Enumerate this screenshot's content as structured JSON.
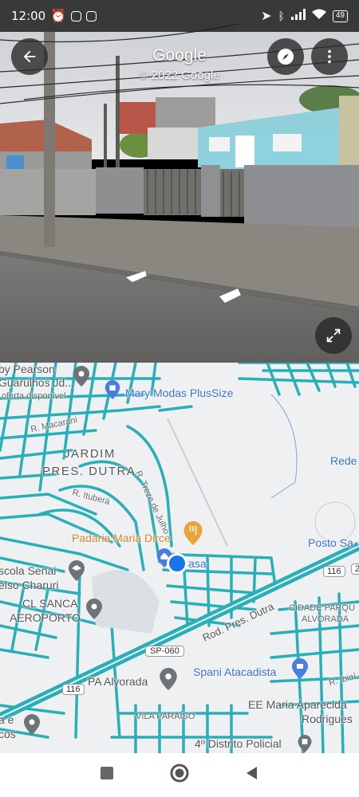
{
  "status_bar": {
    "time": "12:00",
    "battery": "49"
  },
  "street_view": {
    "title": "Google",
    "copyright": "© 2022 Google"
  },
  "map": {
    "labels": {
      "by_pearson": "by Pearson",
      "guarulhos": "Guarulhos Jd...",
      "oferta": "oferta disponível",
      "mary_modas": "Mary Modas PlusSize",
      "r_macarani": "R. Macarani",
      "jardim_1": "JARDIM",
      "jardim_2": "PRES. DUTRA",
      "r_treze": "R. Treze de Julho",
      "r_itubera": "R. Ituberá",
      "rede": "Rede",
      "padaria": "Padaria Maria Dirce",
      "posto": "Posto Sa",
      "escola_1": "scola Senai",
      "escola_2": "elso Charuri",
      "casa": "Casa",
      "cl_sanca_1": "CL SANCA",
      "cl_sanca_2": "AEROPORTO",
      "rod_dutra": "Rod. Pres. Dutra",
      "shield_116a": "116",
      "shield_2": "2",
      "cidade_1": "CIDADE PARQU",
      "cidade_2": "ALVORADA",
      "sp060": "SP-060",
      "spani": "Spani Atacadista",
      "r_ibiai": "R. Ibiaí",
      "shield_116b": "116",
      "pa_alvorada": "PA Alvorada",
      "ee_1": "EE Maria Aparecida",
      "ee_2": "Rodrigues",
      "vila_paraiso": "VILA PARAÍSO",
      "e_left_1": "a e",
      "e_left_2": "cos",
      "distrito": "4º Distrito Policial"
    }
  },
  "icons": {
    "back": "arrow-left-icon",
    "compass": "compass-icon",
    "more": "more-vert-icon",
    "expand": "expand-icon",
    "recents": "square-icon",
    "home": "circle-icon",
    "back_nav": "triangle-back-icon"
  },
  "colors": {
    "road": "#2aaeb8",
    "location_dot": "#1a73e8",
    "poi_blue": "#3a6fd6",
    "poi_orange": "#e8a33b"
  }
}
